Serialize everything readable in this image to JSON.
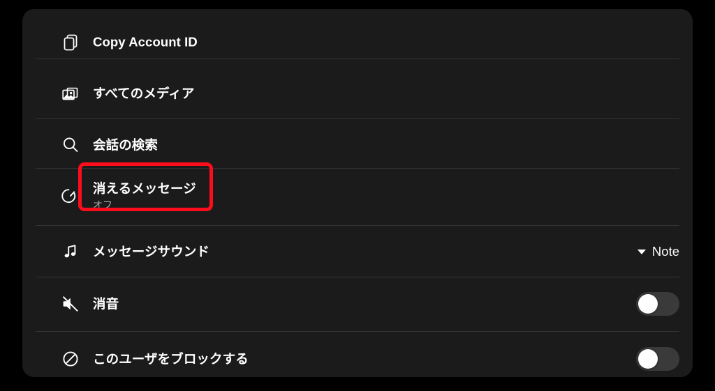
{
  "panel": {
    "background_color": "#1b1b1b",
    "divider_color": "#343434",
    "rows": [
      {
        "id": "copy-account-id",
        "icon": "copy-icon",
        "title": "Copy Account ID",
        "subtitle": "",
        "control": "none"
      },
      {
        "id": "all-media",
        "icon": "photo-icon",
        "title": "すべてのメディア",
        "subtitle": "",
        "control": "none"
      },
      {
        "id": "search-conversation",
        "icon": "search-icon",
        "title": "会話の検索",
        "subtitle": "",
        "control": "none"
      },
      {
        "id": "disappearing-messages",
        "icon": "timer-icon",
        "title": "消えるメッセージ",
        "subtitle": "オフ",
        "control": "none"
      },
      {
        "id": "message-sound",
        "icon": "music-note-icon",
        "title": "メッセージサウンド",
        "subtitle": "",
        "control": "dropdown",
        "value": "Note"
      },
      {
        "id": "mute",
        "icon": "speaker-mute-icon",
        "title": "消音",
        "subtitle": "",
        "control": "toggle",
        "toggle_state": "off"
      },
      {
        "id": "block-user",
        "icon": "block-circle-icon",
        "title": "このユーザをブロックする",
        "subtitle": "",
        "control": "toggle",
        "toggle_state": "off"
      }
    ]
  },
  "annotation": {
    "type": "highlight-box",
    "color": "#fc0d1c",
    "target": "消えるメッセージ"
  }
}
